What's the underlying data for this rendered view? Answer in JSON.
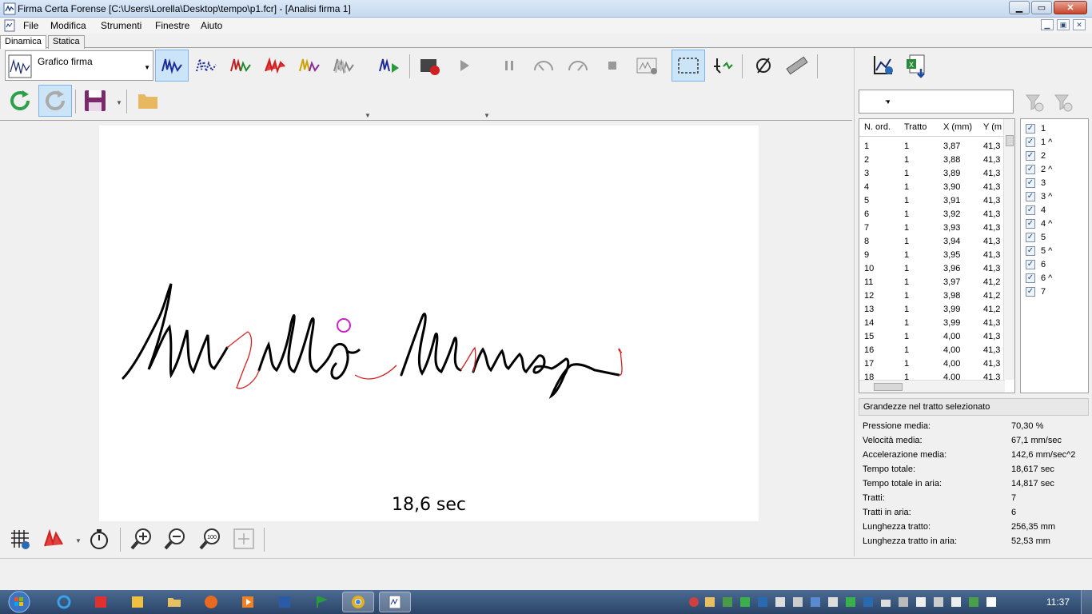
{
  "window": {
    "title": "Firma Certa Forense [C:\\Users\\Lorella\\Desktop\\tempo\\p1.fcr] - [Analisi firma 1]",
    "minimize": "▁",
    "maximize": "▭",
    "close": "✕"
  },
  "menu": {
    "items": [
      {
        "label": "File"
      },
      {
        "label": "Modifica"
      },
      {
        "label": "Strumenti"
      },
      {
        "label": "Finestre"
      },
      {
        "label": "Aiuto"
      }
    ]
  },
  "tabs": [
    {
      "label": "Dinamica",
      "active": true
    },
    {
      "label": "Statica",
      "active": false
    }
  ],
  "toolbar": {
    "graph_combo_value": "Grafico firma",
    "icons": [
      "signature-trace-icon",
      "dotted-trace-icon",
      "pressure-trace-icon",
      "red-trace-icon",
      "multicolor-trace-icon",
      "gray-trace-icon",
      "play-trace-icon",
      "record-icon",
      "play-icon",
      "pause-icon",
      "slow-icon",
      "fast-icon",
      "stop-icon",
      "film-icon",
      "selection-icon",
      "filter-icon",
      "link-icon",
      "ruler-icon"
    ]
  },
  "canvas": {
    "time_label": "18,6 sec"
  },
  "right_panel": {
    "filter_combo_value": "-",
    "table": {
      "columns": [
        "N. ord.",
        "Tratto",
        "X (mm)",
        "Y (m"
      ],
      "rows": [
        [
          "1",
          "1",
          "3,87",
          "41,3"
        ],
        [
          "2",
          "1",
          "3,88",
          "41,3"
        ],
        [
          "3",
          "1",
          "3,89",
          "41,3"
        ],
        [
          "4",
          "1",
          "3,90",
          "41,3"
        ],
        [
          "5",
          "1",
          "3,91",
          "41,3"
        ],
        [
          "6",
          "1",
          "3,92",
          "41,3"
        ],
        [
          "7",
          "1",
          "3,93",
          "41,3"
        ],
        [
          "8",
          "1",
          "3,94",
          "41,3"
        ],
        [
          "9",
          "1",
          "3,95",
          "41,3"
        ],
        [
          "10",
          "1",
          "3,96",
          "41,3"
        ],
        [
          "11",
          "1",
          "3,97",
          "41,2"
        ],
        [
          "12",
          "1",
          "3,98",
          "41,2"
        ],
        [
          "13",
          "1",
          "3,99",
          "41,2"
        ],
        [
          "14",
          "1",
          "3,99",
          "41,3"
        ],
        [
          "15",
          "1",
          "4,00",
          "41,3"
        ],
        [
          "16",
          "1",
          "4,00",
          "41,3"
        ],
        [
          "17",
          "1",
          "4,00",
          "41,3"
        ],
        [
          "18",
          "1",
          "4,00",
          "41,3"
        ]
      ]
    },
    "strokes": [
      "1",
      "1 ^",
      "2",
      "2 ^",
      "3",
      "3 ^",
      "4",
      "4 ^",
      "5",
      "5 ^",
      "6",
      "6 ^",
      "7"
    ],
    "check_mark": "✓",
    "stats_header": "Grandezze nel tratto selezionato",
    "stats": [
      {
        "label": "Pressione media:",
        "value": "70,30 %"
      },
      {
        "label": "Velocità media:",
        "value": "67,1 mm/sec"
      },
      {
        "label": "Accelerazione media:",
        "value": "142,6 mm/sec^2"
      },
      {
        "label": "Tempo totale:",
        "value": "18,617 sec"
      },
      {
        "label": "Tempo totale in aria:",
        "value": "14,817 sec"
      },
      {
        "label": "Tratti:",
        "value": "7"
      },
      {
        "label": "Tratti in aria:",
        "value": "6"
      },
      {
        "label": "Lunghezza tratto:",
        "value": "256,35 mm"
      },
      {
        "label": "Lunghezza tratto in aria:",
        "value": "52,53 mm"
      }
    ]
  },
  "taskbar": {
    "clock": "11:37"
  },
  "colors": {
    "ink": "#000000",
    "air_stroke": "#d42020",
    "marker": "#cc22cc",
    "accent_selected": "#cce4f7"
  }
}
